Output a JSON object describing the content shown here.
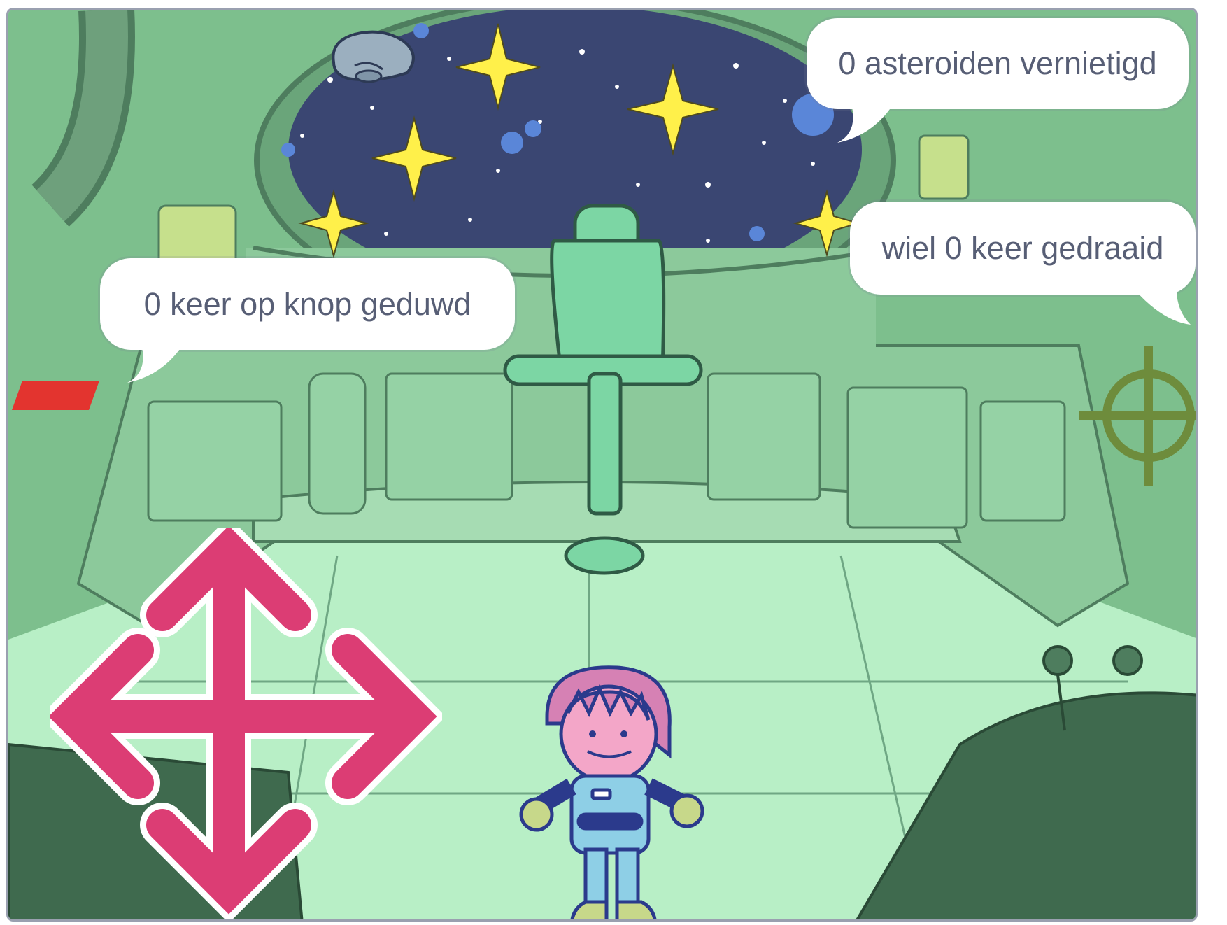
{
  "game": {
    "backdrop": "spaceship-cockpit",
    "bubbles": {
      "asteroids": "0 asteroiden vernietigd",
      "button": "0 keer op knop geduwd",
      "wheel": "wiel 0 keer gedraaid"
    },
    "sprites": {
      "asteroid": "asteroid-rock",
      "joystick": "four-way-arrow",
      "player": "astronaut"
    },
    "colors": {
      "arrow": "#dc3d74",
      "window_sky": "#3a4672",
      "stars": "#fff04a",
      "wall": "#7dbf8d",
      "floor": "#b8f0c4",
      "button": "#e3342f"
    }
  }
}
